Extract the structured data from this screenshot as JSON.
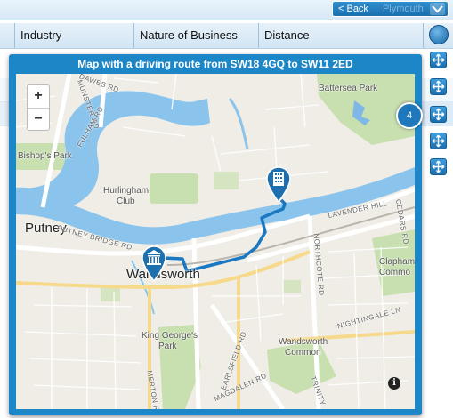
{
  "nav": {
    "back_label": "< Back",
    "ghost_label": "Plymouth"
  },
  "table": {
    "columns": [
      "Industry",
      "Nature of Business",
      "Distance"
    ]
  },
  "badge": {
    "count": "4"
  },
  "modal": {
    "title": "Map with a driving route from SW18 4GQ to SW11 2ED"
  },
  "map": {
    "zoom_in": "+",
    "zoom_out": "−",
    "info": "i",
    "places": {
      "putney": "Putney",
      "wandsworth": "Wandsworth",
      "battersea_park": "Battersea Park",
      "bishops_park": "Bishop's Park",
      "hurlingham": "Hurlingham",
      "club": "Club",
      "king_georges": "King George's",
      "park": "Park",
      "wandsworth_common": "Wandsworth",
      "common": "Common",
      "clapham": "Clapham",
      "clapham_common": "Commo"
    },
    "roads": {
      "dawes": "DAWES RD",
      "munster": "MUNSTER RD",
      "fulham": "FULHAM RD",
      "putney_bridge": "PUTNEY BRIDGE RD",
      "lavender": "LAVENDER HILL",
      "cedars": "CEDARS RD",
      "northcote": "NORTHCOTE RD",
      "nightingale": "NIGHTINGALE LN",
      "earlsfield": "EARLSFIELD RD",
      "magdalen": "MAGDALEN RD",
      "merton": "MERTON RD",
      "trinity": "TRINITY"
    },
    "accent": "#1d86c6",
    "route_color": "#1a78c2"
  }
}
